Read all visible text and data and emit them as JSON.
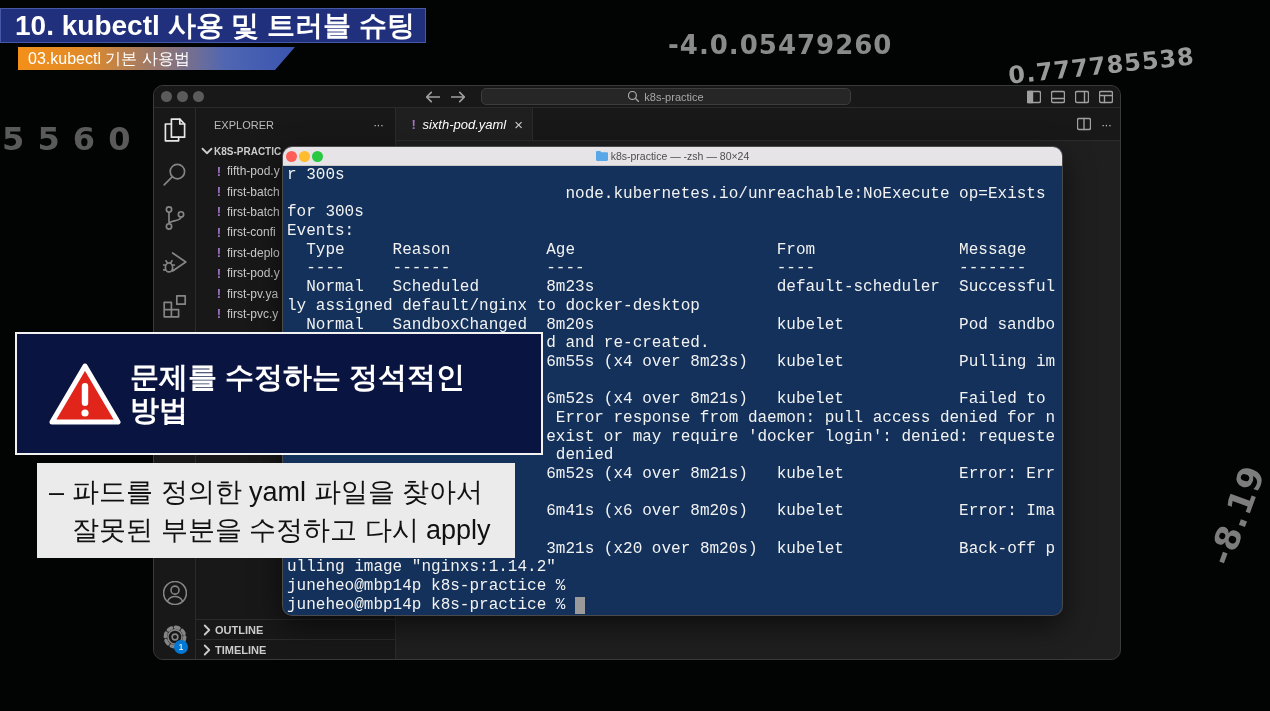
{
  "lesson_banner": {
    "title": "10. kubectl 사용 및 트러블 슈팅",
    "subtitle": "03.kubectl 기본 사용법"
  },
  "background_numbers": [
    "-4.0.05479260",
    "0.777785538",
    "5 5 6 0",
    "-8.19"
  ],
  "editor_window": {
    "focused": false,
    "command_center": "k8s-practice",
    "activity_bar": [
      {
        "kind": "files",
        "selected": true
      },
      {
        "kind": "search",
        "selected": false
      },
      {
        "kind": "source_control",
        "selected": false
      },
      {
        "kind": "run_debug",
        "selected": false
      },
      {
        "kind": "extensions",
        "selected": false
      }
    ],
    "activity_bar_bottom": [
      {
        "kind": "account"
      },
      {
        "kind": "settings",
        "badge": "1"
      }
    ],
    "explorer": {
      "title": "EXPLORER",
      "more": "···",
      "folder": {
        "name": "K8S-PRACTIC",
        "expanded": true,
        "files": [
          {
            "icon": "!",
            "name": "fifth-pod.y"
          },
          {
            "icon": "!",
            "name": "first-batch"
          },
          {
            "icon": "!",
            "name": "first-batch"
          },
          {
            "icon": "!",
            "name": "first-confi"
          },
          {
            "icon": "!",
            "name": "first-deplo"
          },
          {
            "icon": "!",
            "name": "first-pod.y"
          },
          {
            "icon": "!",
            "name": "first-pv.ya"
          },
          {
            "icon": "!",
            "name": "first-pvc.y"
          }
        ]
      },
      "sections": [
        {
          "title": "OUTLINE",
          "expanded": false
        },
        {
          "title": "TIMELINE",
          "expanded": false
        }
      ]
    },
    "tabs": [
      {
        "icon": "!",
        "label": "sixth-pod.yaml",
        "close": "×",
        "selected": true,
        "preview": true
      }
    ],
    "tab_bar_more": "···"
  },
  "terminal": {
    "focused": true,
    "title": "k8s-practice — -zsh — 80×24",
    "segments": [
      [
        "r 300s",
        "                             node.kubernetes.io/unreachable:NoExecute op=Exists",
        "for 300s",
        "Events:",
        "  Type     Reason          Age                     From               Message",
        "  ----     ------          ----                    ----               -------",
        "  Normal   Scheduled       8m23s                   default-scheduler  Successful",
        "ly assigned default/nginx to docker-desktop",
        "  Normal   SandboxChanged  8m20s                   kubelet            Pod sandbo",
        "                           d and re-created.",
        "                           6m55s (x4 over 8m23s)   kubelet            Pulling im"
      ],
      [
        "                           6m52s (x4 over 8m21s)   kubelet            Failed to",
        "                            Error response from daemon: pull access denied for n",
        "                           exist or may require 'docker login': denied: requeste",
        "                            denied",
        "                           6m52s (x4 over 8m21s)   kubelet            Error: Err"
      ],
      [
        "                           6m41s (x6 over 8m20s)   kubelet            Error: Ima"
      ],
      [
        "                           3m21s (x20 over 8m20s)  kubelet            Back-off p",
        "ulling image \"nginxs:1.14.2\"",
        "juneheo@mbp14p k8s-practice %",
        "juneheo@mbp14p k8s-practice %"
      ]
    ],
    "cursor": true
  },
  "callouts": [
    {
      "kind": "alert",
      "text": "문제를 수정하는 정석적인 방법"
    },
    {
      "kind": "note",
      "marker": "–",
      "text": "파드를 정의한 yaml 파일을 찾아서 잘못된 부분을 수정하고 다시 apply"
    }
  ]
}
